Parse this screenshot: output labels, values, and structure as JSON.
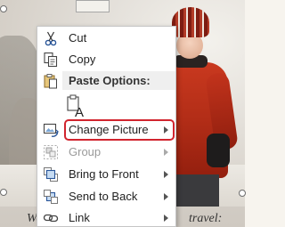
{
  "context_menu": {
    "items": [
      {
        "label": "Cut",
        "icon": "scissors-icon",
        "enabled": true,
        "submenu": false
      },
      {
        "label": "Copy",
        "icon": "copy-icon",
        "enabled": true,
        "submenu": false
      },
      {
        "label": "Change Picture",
        "icon": "change-picture-icon",
        "enabled": true,
        "submenu": true
      },
      {
        "label": "Group",
        "icon": "group-icon",
        "enabled": false,
        "submenu": true
      },
      {
        "label": "Bring to Front",
        "icon": "bring-to-front-icon",
        "enabled": true,
        "submenu": true
      },
      {
        "label": "Send to Back",
        "icon": "send-to-back-icon",
        "enabled": true,
        "submenu": true
      },
      {
        "label": "Link",
        "icon": "link-icon",
        "enabled": true,
        "submenu": true
      }
    ],
    "paste_options": {
      "heading": "Paste Options:",
      "option_icon": "paste-keep-text-only-icon"
    },
    "highlighted_item": "Change Picture",
    "highlight_color": "#d1242e"
  },
  "document": {
    "text_left": "We",
    "text_right": "travel:"
  }
}
